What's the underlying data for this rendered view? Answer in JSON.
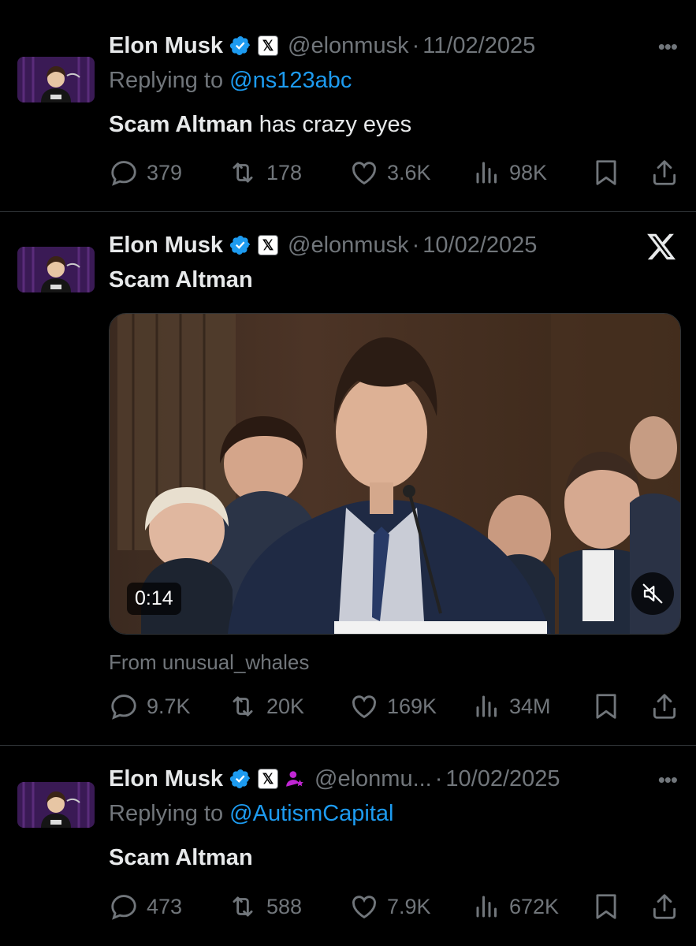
{
  "tweets": [
    {
      "name": "Elon Musk",
      "handle": "@elonmusk",
      "dot": "·",
      "date": "11/02/2025",
      "replying_prefix": "Replying to ",
      "replying_to": "@ns123abc",
      "text_bold": "Scam Altman",
      "text_rest": " has crazy eyes",
      "more": "•••",
      "stats": {
        "replies": "379",
        "reposts": "178",
        "likes": "3.6K",
        "views": "98K"
      }
    },
    {
      "name": "Elon Musk",
      "handle": "@elonmusk",
      "dot": "·",
      "date": "10/02/2025",
      "text_bold": "Scam Altman",
      "video_time": "0:14",
      "from": "From unusual_whales",
      "stats": {
        "replies": "9.7K",
        "reposts": "20K",
        "likes": "169K",
        "views": "34M"
      }
    },
    {
      "name": "Elon Musk",
      "handle": "@elonmu...",
      "dot": "·",
      "date": "10/02/2025",
      "replying_prefix": "Replying to ",
      "replying_to": "@AutismCapital",
      "text_bold": "Scam Altman",
      "more": "•••",
      "stats": {
        "replies": "473",
        "reposts": "588",
        "likes": "7.9K",
        "views": "672K"
      }
    }
  ],
  "icons": {
    "verified": "verified-badge-icon",
    "x_badge": "x-affiliate-badge-icon",
    "reply": "reply-icon",
    "repost": "repost-icon",
    "like": "heart-icon",
    "views": "views-icon",
    "bookmark": "bookmark-icon",
    "share": "share-icon",
    "mute": "mute-icon",
    "x_logo": "x-logo-icon"
  },
  "x_badge_glyph": "𝕏",
  "colors": {
    "background": "#000000",
    "link": "#1d9bf0",
    "muted": "#71767b",
    "text": "#e7e9ea",
    "verified": "#1d9bf0"
  }
}
